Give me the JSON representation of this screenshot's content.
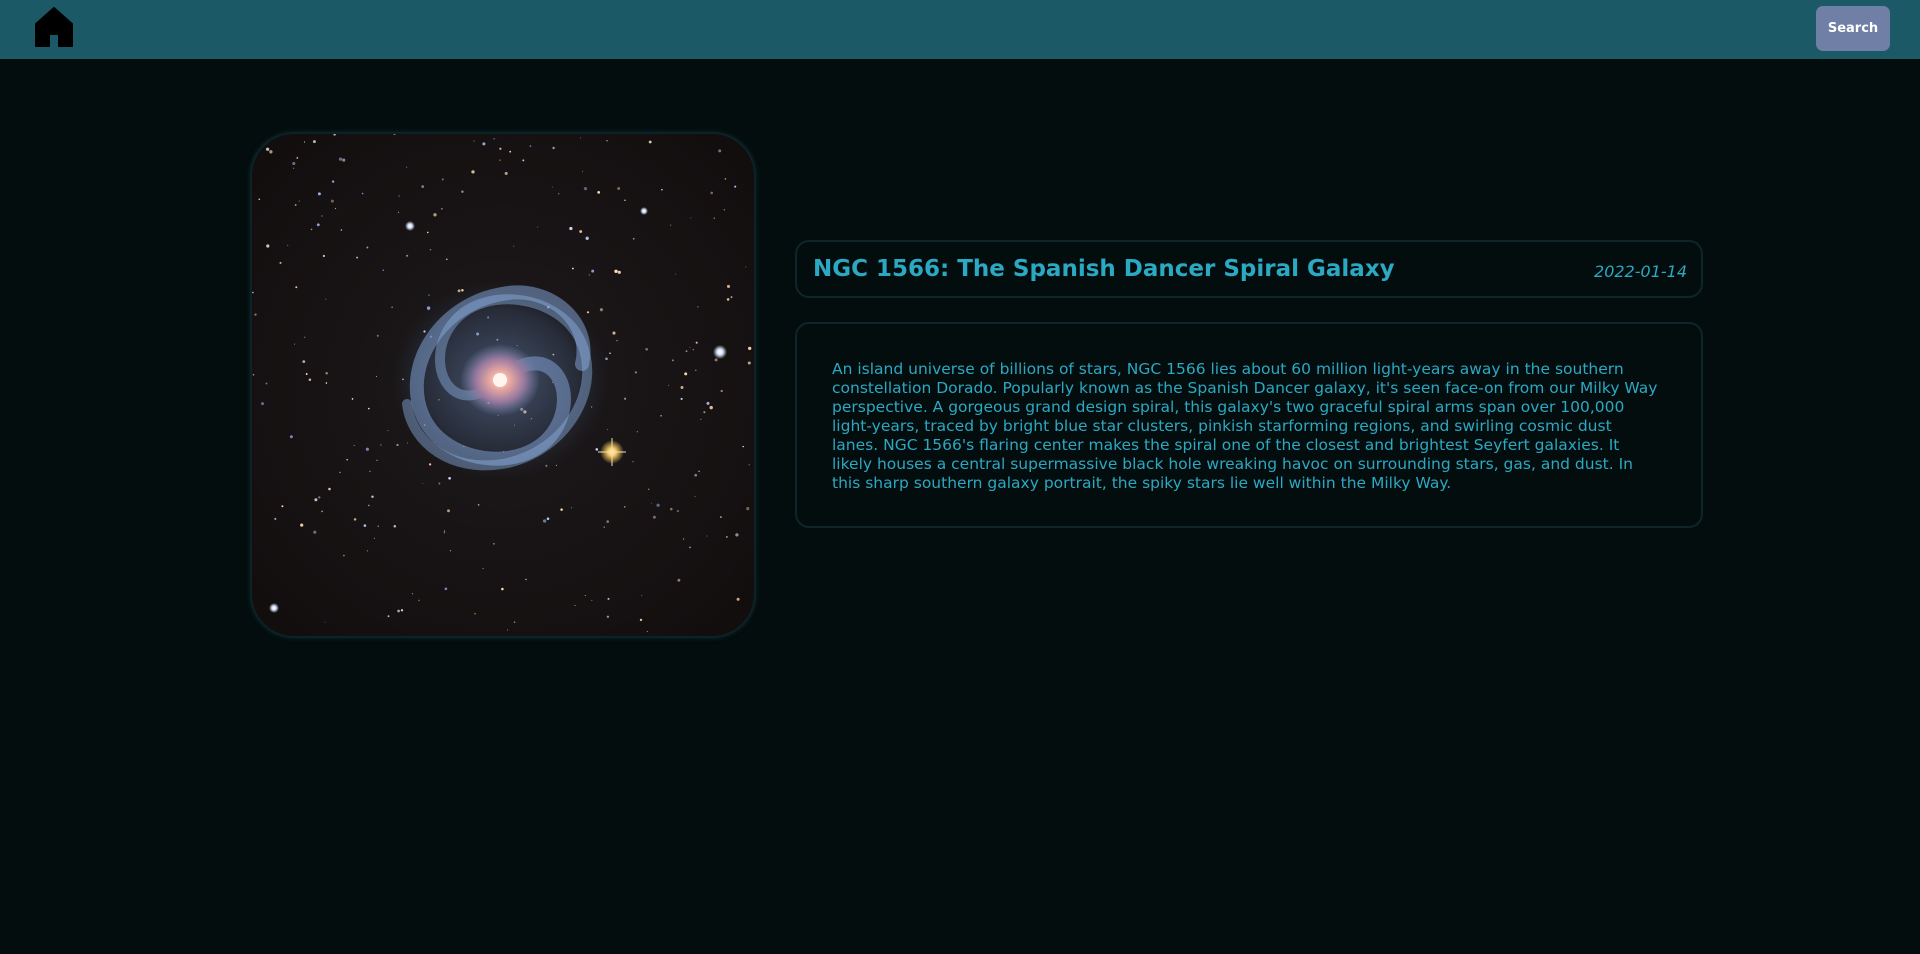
{
  "header": {
    "home_icon": "home-icon",
    "search_label": "Search",
    "bar_color": "#1c5966",
    "search_color": "#6f7fa5"
  },
  "entry": {
    "image_subject": "galaxy-photo",
    "title": "NGC 1566: The Spanish Dancer Spiral Galaxy",
    "date": "2022-01-14",
    "description": "An island universe of billions of stars, NGC 1566 lies about 60 million light-years away in the southern constellation Dorado. Popularly known as the Spanish Dancer galaxy, it's seen face-on from our Milky Way perspective. A gorgeous grand design spiral, this galaxy's two graceful spiral arms span over 100,000 light-years, traced by bright blue star clusters, pinkish starforming regions, and swirling cosmic dust lanes. NGC 1566's flaring center makes the spiral one of the closest and brightest Seyfert galaxies. It likely houses a central supermassive black hole wreaking havoc on surrounding stars, gas, and dust. In this sharp southern galaxy portrait, the spiky stars lie well within the Milky Way.",
    "accent_color": "#2ba8c2"
  }
}
